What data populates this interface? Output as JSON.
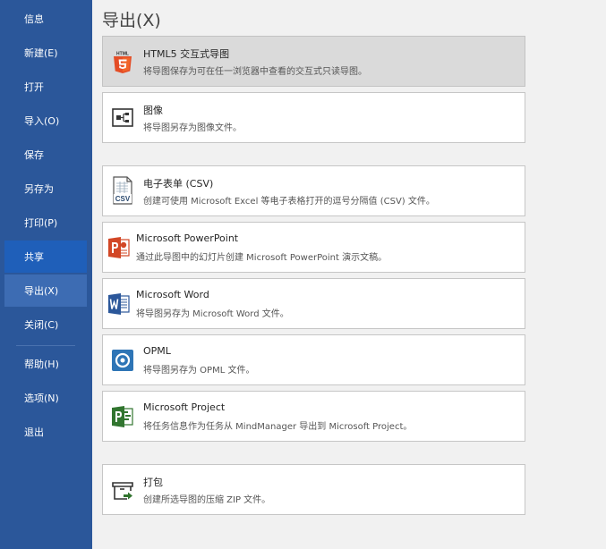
{
  "sidebar": {
    "items": [
      {
        "label": "信息"
      },
      {
        "label": "新建(E)"
      },
      {
        "label": "打开"
      },
      {
        "label": "导入(O)"
      },
      {
        "label": "保存"
      },
      {
        "label": "另存为"
      },
      {
        "label": "打印(P)"
      },
      {
        "label": "共享"
      },
      {
        "label": "导出(X)"
      },
      {
        "label": "关闭(C)"
      },
      {
        "label": "帮助(H)"
      },
      {
        "label": "选项(N)"
      },
      {
        "label": "退出"
      }
    ]
  },
  "page": {
    "title": "导出(X)"
  },
  "export_items": [
    {
      "title": "HTML5 交互式导图",
      "description": "将导图保存为可在任一浏览器中查看的交互式只读导图。",
      "icon": "html5-icon",
      "icon_text": "HTML"
    },
    {
      "title": "图像",
      "description": "将导图另存为图像文件。",
      "icon": "image-map-icon"
    },
    {
      "title": "电子表单 (CSV)",
      "description": "创建可使用 Microsoft Excel 等电子表格打开的逗号分隔值 (CSV) 文件。",
      "icon": "csv-icon",
      "icon_text": "CSV"
    },
    {
      "title": "Microsoft PowerPoint",
      "description": "通过此导图中的幻灯片创建 Microsoft PowerPoint 演示文稿。",
      "icon": "powerpoint-icon"
    },
    {
      "title": "Microsoft Word",
      "description": "将导图另存为 Microsoft Word 文件。",
      "icon": "word-icon"
    },
    {
      "title": "OPML",
      "description": "将导图另存为 OPML 文件。",
      "icon": "opml-icon"
    },
    {
      "title": "Microsoft Project",
      "description": "将任务信息作为任务从 MindManager 导出到 Microsoft Project。",
      "icon": "project-icon"
    },
    {
      "title": "打包",
      "description": "创建所选导图的压缩 ZIP 文件。",
      "icon": "package-icon"
    }
  ],
  "colors": {
    "sidebar": "#2b579a",
    "sidebar_selected": "#1f5fb9",
    "sidebar_hover": "#3d6cb3",
    "html5": "#e44d26",
    "powerpoint": "#d24726",
    "word": "#2b579a",
    "opml": "#2e75b6",
    "project": "#31752f"
  }
}
